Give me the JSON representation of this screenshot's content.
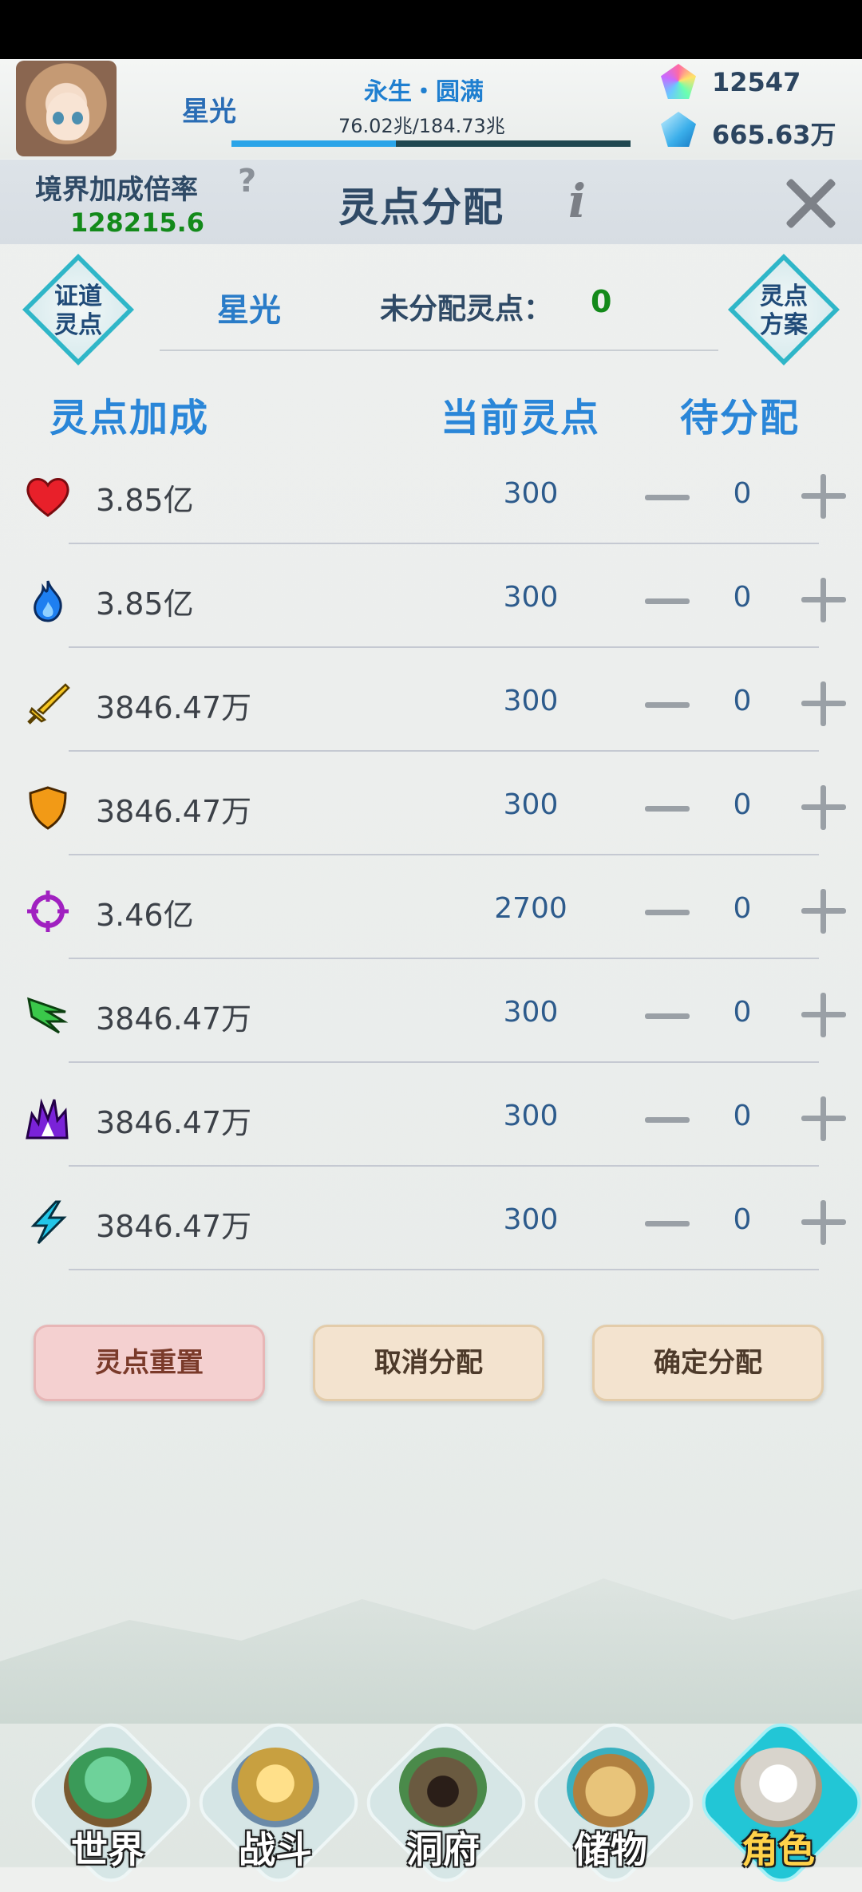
{
  "header": {
    "player_name": "星光",
    "realm": "永生・圆满",
    "exp_text": "76.02兆/184.73兆",
    "exp_progress": 0.4115,
    "currency1": "12547",
    "currency2": "665.63万"
  },
  "panel": {
    "bonus_label": "境界加成倍率",
    "bonus_help": "?",
    "bonus_value": "128215.6",
    "title": "灵点分配",
    "info": "i"
  },
  "alloc": {
    "left_button": [
      "证道",
      "灵点"
    ],
    "right_button": [
      "灵点",
      "方案"
    ],
    "char_name": "星光",
    "unalloc_label": "未分配灵点：",
    "unalloc_value": "0"
  },
  "columns": {
    "bonus": "灵点加成",
    "current": "当前灵点",
    "pending": "待分配"
  },
  "rows": [
    {
      "icon": "heart-icon",
      "bonus": "3.85亿",
      "current": "300",
      "pending": "0"
    },
    {
      "icon": "flame-icon",
      "bonus": "3.85亿",
      "current": "300",
      "pending": "0"
    },
    {
      "icon": "sword-icon",
      "bonus": "3846.47万",
      "current": "300",
      "pending": "0"
    },
    {
      "icon": "shield-icon",
      "bonus": "3846.47万",
      "current": "300",
      "pending": "0"
    },
    {
      "icon": "crosshair-icon",
      "bonus": "3.46亿",
      "current": "2700",
      "pending": "0"
    },
    {
      "icon": "wing-icon",
      "bonus": "3846.47万",
      "current": "300",
      "pending": "0"
    },
    {
      "icon": "burst-icon",
      "bonus": "3846.47万",
      "current": "300",
      "pending": "0"
    },
    {
      "icon": "lightning-icon",
      "bonus": "3846.47万",
      "current": "300",
      "pending": "0"
    }
  ],
  "buttons": {
    "reset": "灵点重置",
    "cancel": "取消分配",
    "confirm": "确定分配"
  },
  "nav": [
    {
      "label": "世界",
      "icon": "island-icon"
    },
    {
      "label": "战斗",
      "icon": "battle-shield-icon"
    },
    {
      "label": "洞府",
      "icon": "cave-icon"
    },
    {
      "label": "储物",
      "icon": "bag-icon"
    },
    {
      "label": "角色",
      "icon": "character-icon",
      "active": true
    }
  ],
  "colors": {
    "accent_blue": "#2a86d8",
    "value_green": "#138a1a",
    "active_nav": "#22c6d6"
  }
}
